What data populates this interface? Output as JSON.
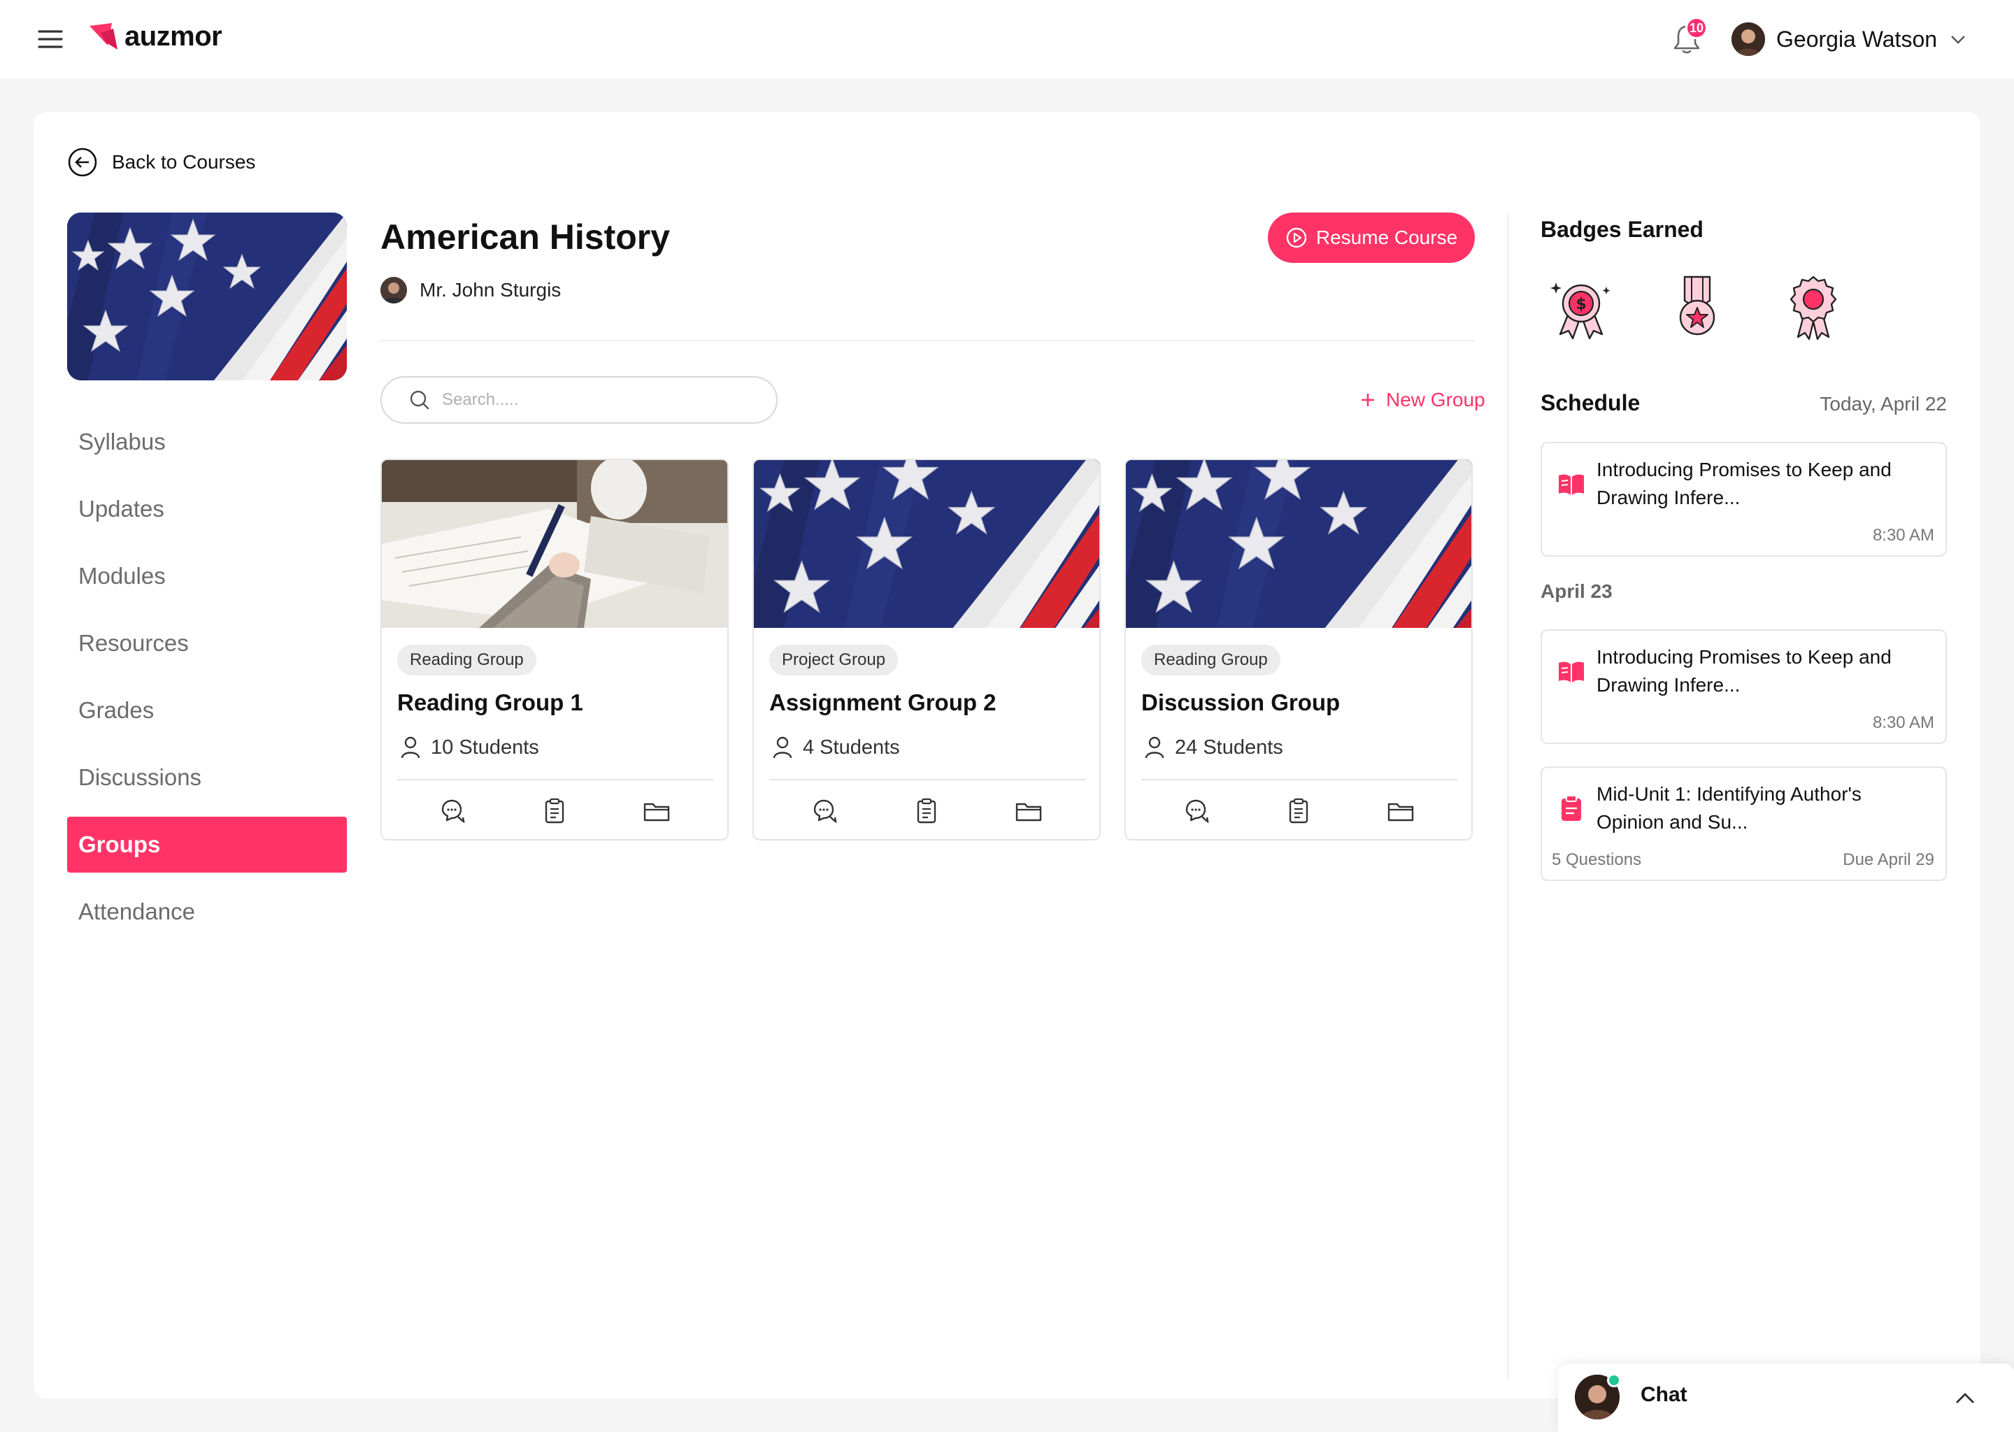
{
  "header": {
    "brand": "auzmor",
    "notification_count": "10",
    "user_name": "Georgia Watson"
  },
  "back_label": "Back to Courses",
  "course": {
    "title": "American History",
    "teacher": "Mr. John Sturgis",
    "resume_label": "Resume Course"
  },
  "nav": {
    "items": [
      {
        "label": "Syllabus"
      },
      {
        "label": "Updates"
      },
      {
        "label": "Modules"
      },
      {
        "label": "Resources"
      },
      {
        "label": "Grades"
      },
      {
        "label": "Discussions"
      },
      {
        "label": "Groups"
      },
      {
        "label": "Attendance"
      }
    ],
    "active": "Groups"
  },
  "groups": {
    "search_placeholder": "Search.....",
    "new_group_label": "New Group",
    "cards": [
      {
        "tag": "Reading Group",
        "title": "Reading Group 1",
        "students": "10 Students",
        "image": "writing-photo"
      },
      {
        "tag": "Project Group",
        "title": "Assignment Group 2",
        "students": "4 Students",
        "image": "flag-photo"
      },
      {
        "tag": "Reading Group",
        "title": "Discussion Group",
        "students": "24 Students",
        "image": "flag-photo"
      }
    ]
  },
  "badges": {
    "title": "Badges Earned",
    "icons": [
      "dollar-medal-icon",
      "star-medal-icon",
      "rosette-badge-icon"
    ]
  },
  "schedule": {
    "title": "Schedule",
    "today_label": "Today, April 22",
    "items": [
      {
        "text": "Introducing Promises to Keep and Drawing Infere...",
        "time": "8:30 AM",
        "icon": "book-icon"
      },
      {
        "text": "Introducing Promises to Keep and Drawing Infere...",
        "time": "8:30 AM",
        "icon": "book-icon"
      },
      {
        "text": "Mid-Unit 1: Identifying Author's Opinion and Su...",
        "questions": "5 Questions",
        "due": "Due April 29",
        "icon": "clipboard-icon"
      }
    ],
    "second_day_label": "April 23"
  },
  "chat": {
    "label": "Chat"
  },
  "colors": {
    "accent": "#ff3366",
    "text": "#111111",
    "muted": "#6b6b6b",
    "online": "#20c997"
  }
}
